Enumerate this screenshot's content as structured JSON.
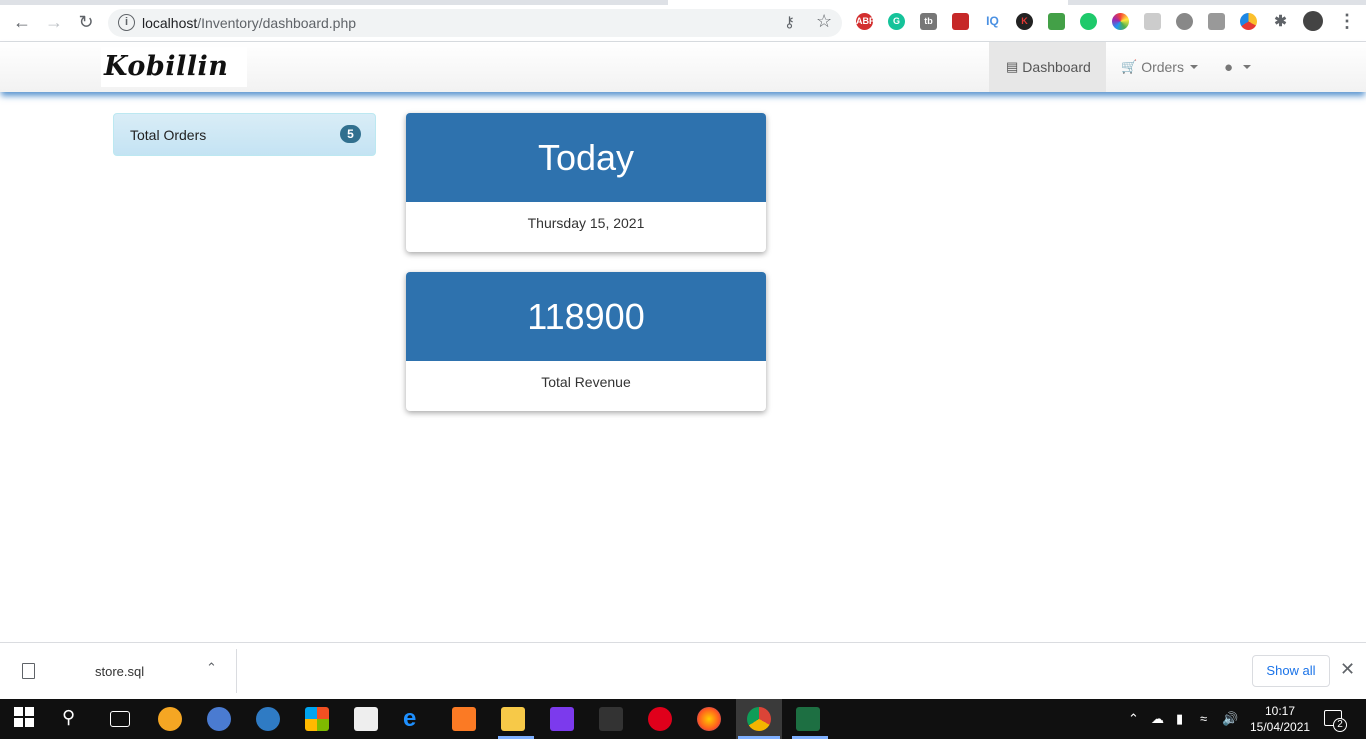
{
  "browser": {
    "url_host": "localhost",
    "url_path": "/Inventory/dashboard.php"
  },
  "navbar": {
    "brand": "Kobillin",
    "dashboard_label": "Dashboard",
    "orders_label": "Orders"
  },
  "sidebar": {
    "total_orders_label": "Total Orders",
    "total_orders_count": "5"
  },
  "cards": {
    "today": {
      "title": "Today",
      "subtitle": "Thursday 15, 2021"
    },
    "revenue": {
      "title": "118900",
      "subtitle": "Total Revenue"
    }
  },
  "downloads": {
    "file_name": "store.sql",
    "show_all_label": "Show all"
  },
  "taskbar": {
    "time": "10:17",
    "date": "15/04/2021",
    "notification_count": "2"
  },
  "colors": {
    "card_header": "#2e72ae",
    "list_item_bg": "#d9edf7",
    "badge": "#31708f"
  }
}
